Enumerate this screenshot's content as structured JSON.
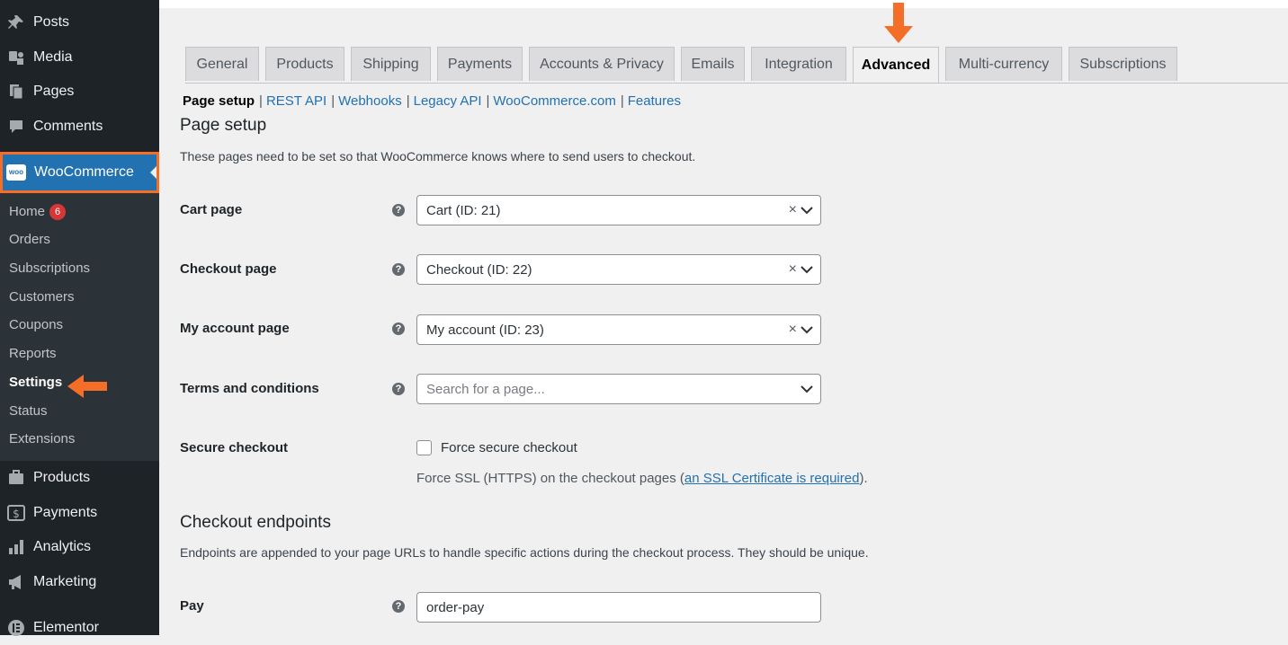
{
  "sidebar": {
    "top_items": [
      {
        "label": "Posts",
        "icon": "pin-icon"
      },
      {
        "label": "Media",
        "icon": "media-icon"
      },
      {
        "label": "Pages",
        "icon": "pages-icon"
      },
      {
        "label": "Comments",
        "icon": "comments-icon"
      }
    ],
    "woocommerce": {
      "label": "WooCommerce",
      "logo_text": "woo"
    },
    "submenu": [
      {
        "label": "Home",
        "badge": "6"
      },
      {
        "label": "Orders"
      },
      {
        "label": "Subscriptions"
      },
      {
        "label": "Customers"
      },
      {
        "label": "Coupons"
      },
      {
        "label": "Reports"
      },
      {
        "label": "Settings",
        "current": true
      },
      {
        "label": "Status"
      },
      {
        "label": "Extensions"
      }
    ],
    "bottom_items": [
      {
        "label": "Products",
        "icon": "products-icon"
      },
      {
        "label": "Payments",
        "icon": "payments-icon"
      },
      {
        "label": "Analytics",
        "icon": "analytics-icon"
      },
      {
        "label": "Marketing",
        "icon": "marketing-icon"
      },
      {
        "label": "Elementor",
        "icon": "elementor-icon"
      }
    ]
  },
  "tabs": [
    "General",
    "Products",
    "Shipping",
    "Payments",
    "Accounts & Privacy",
    "Emails",
    "Integration",
    "Advanced",
    "Multi-currency",
    "Subscriptions"
  ],
  "active_tab": "Advanced",
  "subsubsub": [
    {
      "label": "Page setup",
      "current": true
    },
    {
      "label": "REST API"
    },
    {
      "label": "Webhooks"
    },
    {
      "label": "Legacy API"
    },
    {
      "label": "WooCommerce.com"
    },
    {
      "label": "Features"
    }
  ],
  "page_setup": {
    "title": "Page setup",
    "description": "These pages need to be set so that WooCommerce knows where to send users to checkout.",
    "rows": [
      {
        "label": "Cart page",
        "value": "Cart (ID: 21)"
      },
      {
        "label": "Checkout page",
        "value": "Checkout (ID: 22)"
      },
      {
        "label": "My account page",
        "value": "My account (ID: 23)"
      },
      {
        "label": "Terms and conditions",
        "placeholder": "Search for a page..."
      }
    ],
    "secure_checkout": {
      "label": "Secure checkout",
      "checkbox_label": "Force secure checkout",
      "checked": false,
      "desc_prefix": "Force SSL (HTTPS) on the checkout pages (",
      "desc_link": "an SSL Certificate is required",
      "desc_suffix": ")."
    }
  },
  "checkout_endpoints": {
    "title": "Checkout endpoints",
    "description": "Endpoints are appended to your page URLs to handle specific actions during the checkout process. They should be unique.",
    "rows": [
      {
        "label": "Pay",
        "value": "order-pay"
      }
    ]
  },
  "help_glyph": "?",
  "clear_glyph": "×",
  "accent_colors": {
    "highlight": "#f56e28",
    "wp_blue": "#2271b1",
    "sidebar": "#1d2327"
  }
}
